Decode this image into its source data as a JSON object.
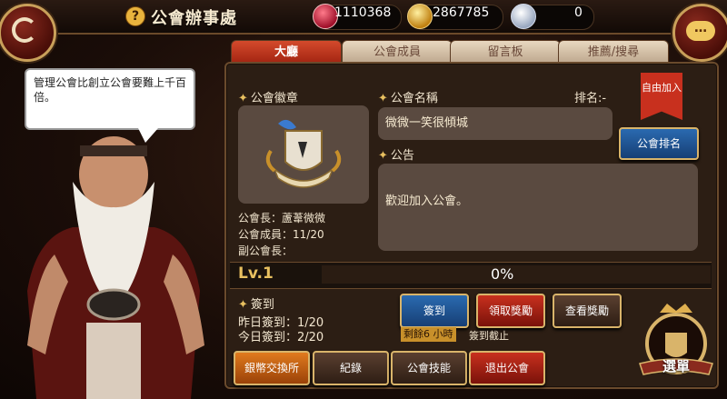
{
  "header": {
    "title": "公會辦事處",
    "resources": [
      {
        "icon": "ruby-gem-icon",
        "value": "1110368"
      },
      {
        "icon": "gold-crystal-icon",
        "value": "2867785"
      },
      {
        "icon": "silver-diamond-icon",
        "value": "0"
      }
    ]
  },
  "tabs": [
    {
      "label": "大廳",
      "active": true
    },
    {
      "label": "公會成員",
      "active": false
    },
    {
      "label": "留言板",
      "active": false
    },
    {
      "label": "推薦/搜尋",
      "active": false
    }
  ],
  "npc": {
    "speech": "管理公會比創立公會要難上千百倍。"
  },
  "guild": {
    "emblem_label": "公會徽章",
    "name_label": "公會名稱",
    "rank_label": "排名:-",
    "name_value": "微微一笑很傾城",
    "notice_label": "公告",
    "notice_value": "歡迎加入公會。",
    "free_join_badge": "自由加入",
    "rank_button": "公會排名",
    "leader": "公會長：蘆葦微微",
    "members": "公會成員：11/20",
    "vice_leader": "副公會長："
  },
  "level": {
    "label": "Lv.1",
    "progress_text": "0%",
    "progress": 0
  },
  "checkin": {
    "label": "簽到",
    "yesterday": "昨日簽到：1/20",
    "today": "今日簽到：2/20",
    "checkin_button": "簽到",
    "claim_button": "領取獎勵",
    "view_button": "查看獎勵",
    "remaining_badge": "剩餘6 小時",
    "deadline_text": "簽到截止"
  },
  "bottom_buttons": {
    "exchange": "銀幣交換所",
    "records": "紀錄",
    "skills": "公會技能",
    "leave": "退出公會"
  },
  "menu_button": "選單",
  "colors": {
    "accent_red": "#c8301e",
    "gold": "#d9b46a",
    "blue": "#2a6ab0"
  }
}
